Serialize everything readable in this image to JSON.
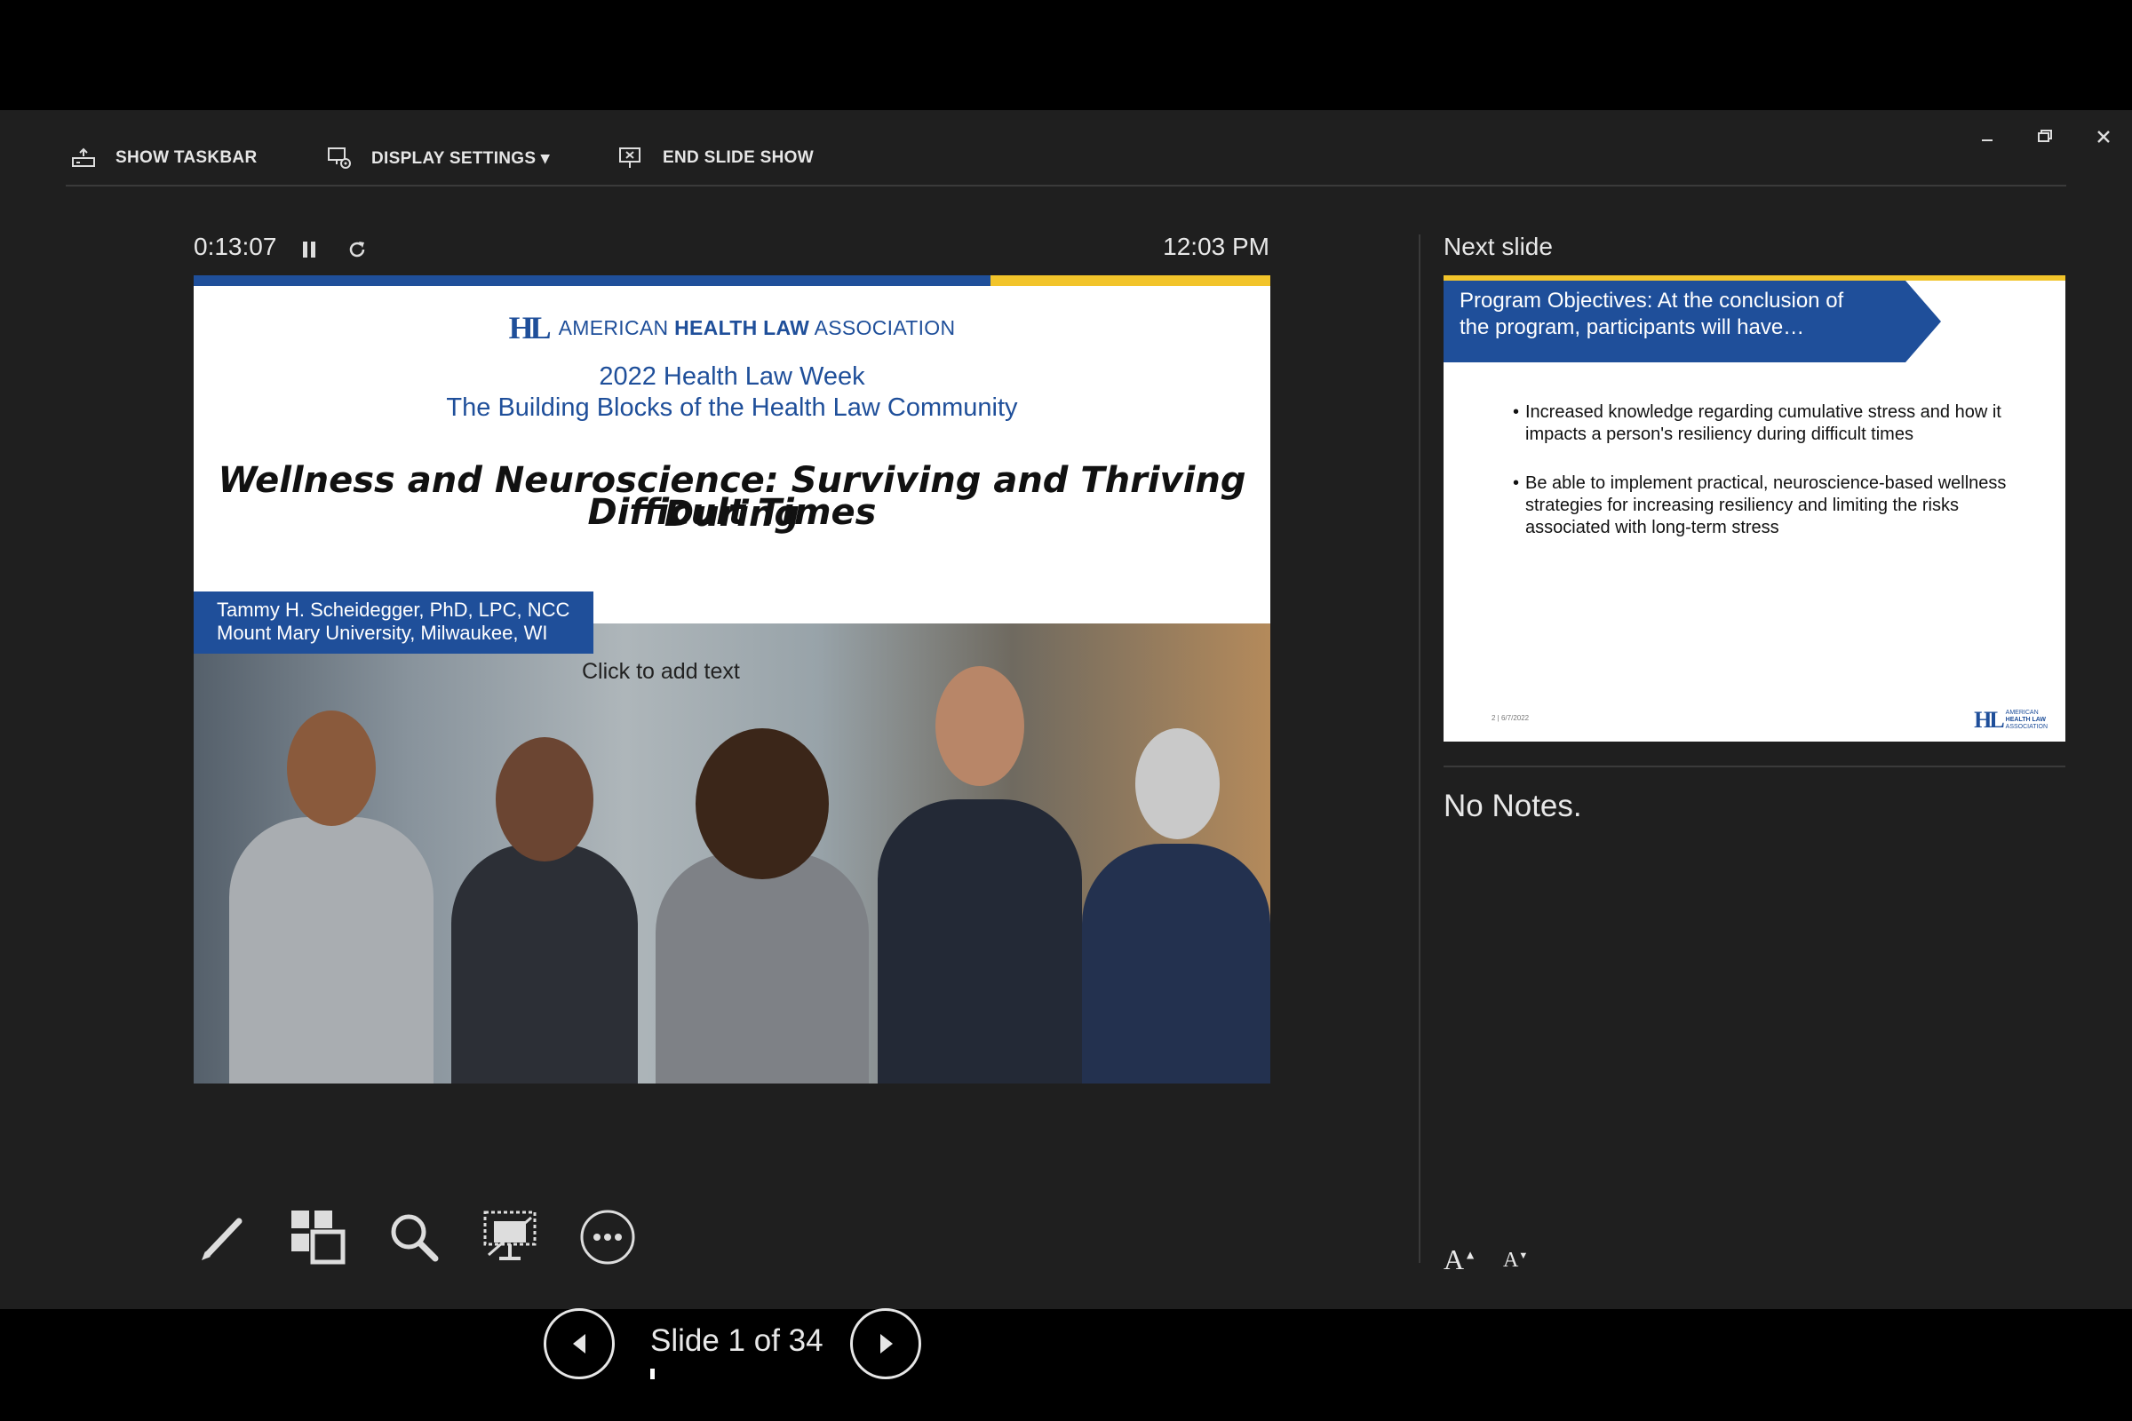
{
  "toolbar": {
    "show_taskbar": "SHOW TASKBAR",
    "display_settings": "DISPLAY SETTINGS ▾",
    "end_slide_show": "END SLIDE SHOW"
  },
  "presenter": {
    "elapsed": "0:13:07",
    "clock": "12:03 PM",
    "next_label": "Next slide",
    "notes": "No Notes.",
    "slide_counter": "Slide 1 of 34",
    "progress_fraction": 0.029
  },
  "current_slide": {
    "org": "AMERICAN",
    "org_bold": "HEALTH LAW",
    "org_end": "ASSOCIATION",
    "subtitle1": "2022 Health Law Week",
    "subtitle2": "The Building Blocks of the Health Law Community",
    "title1": "Wellness and Neuroscience:  Surviving and Thriving During",
    "title2": "Difficult Times",
    "speaker_line1": "Tammy H. Scheidegger, PhD, LPC, NCC",
    "speaker_line2": "Mount Mary University, Milwaukee, WI",
    "placeholder": "Click to add text"
  },
  "next_slide": {
    "banner_line1": "Program Objectives: At the conclusion of",
    "banner_line2": "the program, participants will have…",
    "bullet1": "Increased knowledge regarding cumulative stress and how it impacts a person's resiliency during difficult times",
    "bullet2": "Be able to implement practical, neuroscience-based wellness strategies for increasing resiliency and limiting the risks associated with long-term stress",
    "footer": "2 | 6/7/2022",
    "logo_text1": "AMERICAN",
    "logo_text2": "HEALTH LAW",
    "logo_text3": "ASSOCIATION"
  },
  "colors": {
    "brand_blue": "#1f4f9a",
    "brand_yellow": "#f2c42a",
    "background": "#1f1f1f"
  }
}
